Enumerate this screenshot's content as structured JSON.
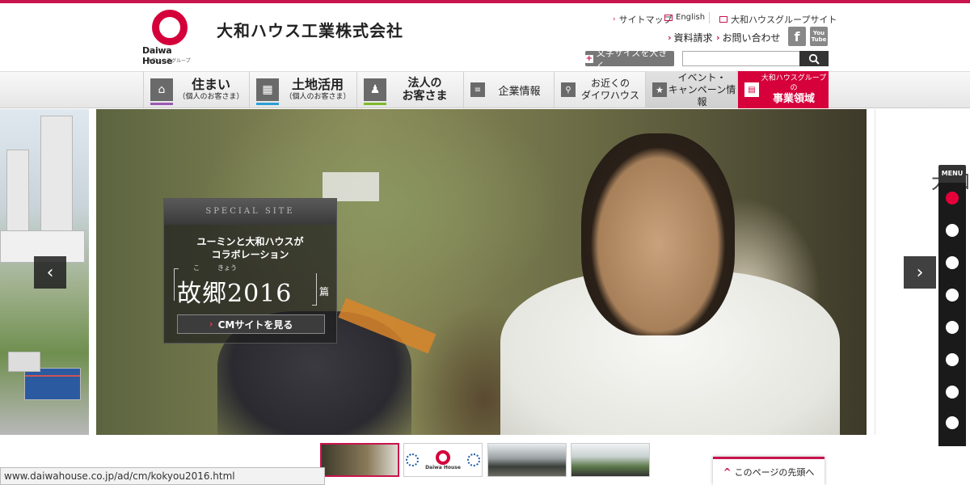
{
  "header": {
    "logo_text": "Daiwa House",
    "logo_sub": "大和ハウスグループ",
    "company_name": "大和ハウス工業株式会社",
    "util_links": {
      "sitemap": "サイトマップ",
      "english": "English",
      "group_site": "大和ハウスグループサイト"
    },
    "util_links2": {
      "request_docs": "資料請求",
      "contact": "お問い合わせ"
    },
    "sns": {
      "facebook": "f",
      "youtube_1": "You",
      "youtube_2": "Tube"
    },
    "font_size_button": "文字サイズを大きく",
    "search": {
      "placeholder": ""
    }
  },
  "nav": {
    "items": [
      {
        "main": "住まい",
        "sub": "（個人のお客さま）",
        "bar_color": "#9b59b6"
      },
      {
        "main": "土地活用",
        "sub": "（個人のお客さま）",
        "bar_color": "#2a9fd6"
      },
      {
        "line1": "法人の",
        "line2": "お客さま",
        "bar_color": "#7fba2a"
      },
      {
        "label": "企業情報"
      },
      {
        "line1": "お近くの",
        "line2": "ダイワハウス"
      },
      {
        "line1": "イベント・",
        "line2": "キャンペーン情報"
      },
      {
        "line1": "大和ハウスグループの",
        "line2": "事業領域"
      }
    ]
  },
  "hero": {
    "special_site": "SPECIAL SITE",
    "line1": "ユーミンと大和ハウスが",
    "line2": "コラボレーション",
    "ruby_ko": "こ",
    "ruby_kyou": "きょう",
    "title": "故郷2016",
    "suffix": "篇",
    "cm_button": "CMサイトを見る",
    "side_text": "大和"
  },
  "menu": {
    "label": "MENU",
    "dot_count": 8,
    "active_index": 0
  },
  "thumbs": {
    "thumb_b_label": "Daiwa House"
  },
  "pagetop": "このページの先頭へ",
  "status_url": "www.daiwahouse.co.jp/ad/cm/kokyou2016.html",
  "colors": {
    "brand_red": "#d4003a",
    "accent": "#c8144d"
  }
}
